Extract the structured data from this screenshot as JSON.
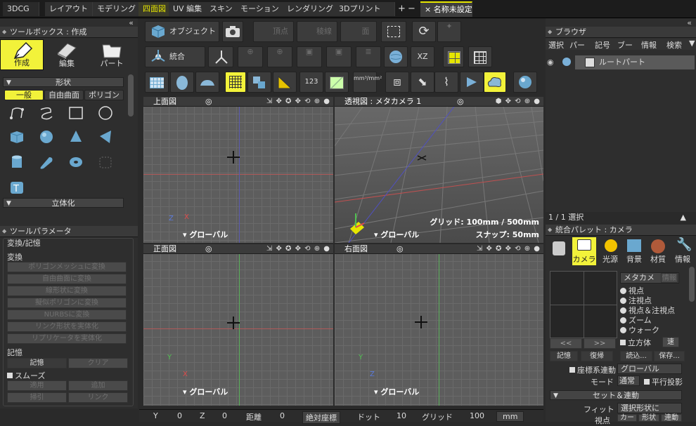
{
  "topbar": {
    "app_title": "3DCG",
    "tabs": [
      "レイアウト",
      "モデリング",
      "四面図",
      "UV 編集",
      "スキン",
      "モーション",
      "レンダリング",
      "3Dプリント"
    ],
    "add_symbol": "+",
    "minus_symbol": "−",
    "doc_close": "×",
    "doc_title": "名称未設定"
  },
  "toolbox": {
    "header": "ツールボックス : 作成",
    "collapse": "«",
    "modes": [
      "作成",
      "編集",
      "パート"
    ],
    "shape_section": "形状",
    "shape_tabs": [
      "一般",
      "自由曲面",
      "ポリゴン"
    ],
    "solid_section": "立体化"
  },
  "toolparam": {
    "header": "ツールパラメータ",
    "group_title": "変換/記憶",
    "convert_label": "変換",
    "convert_buttons": [
      "ポリゴンメッシュに変換",
      "自由曲面に変換",
      "線形状に変換",
      "擬似ポリゴンに変換",
      "NURBSに変換",
      "リンク形状を実体化",
      "リプリケータを実体化"
    ],
    "memory_label": "記憶",
    "memory_button": "記憶",
    "clear_button": "クリア",
    "smooth_label": "スムーズ",
    "apply_button": "適用",
    "add_button": "追加",
    "subtract_button": "掃引",
    "link_button": "リンク"
  },
  "toolbar": {
    "object_button": "オブジェクト",
    "vertex_button": "頂点",
    "edge_button": "稜線",
    "face_button": "面",
    "integrate_button": "統合",
    "xz_label": "XZ",
    "num_label": "123",
    "unit_label": "mm³/mm²"
  },
  "viewports": {
    "top": {
      "title": "上面図",
      "global": "グローバル"
    },
    "persp": {
      "title": "透視図 : メタカメラ 1",
      "global": "グローバル",
      "grid_info": "グリッド: 100mm / 500mm",
      "snap_info": "スナップ: 50mm"
    },
    "front": {
      "title": "正面図",
      "global": "グローバル"
    },
    "right": {
      "title": "右面図",
      "global": "グローバル"
    },
    "axis_x": "X",
    "axis_y": "Y",
    "axis_z": "Z"
  },
  "status": {
    "y_label": "Y",
    "y_value": "0",
    "z_label": "Z",
    "z_value": "0",
    "dist_label": "距離",
    "dist_value": "0",
    "coord_mode": "絶対座標",
    "dot_label": "ドット",
    "dot_value": "10",
    "grid_label": "グリッド",
    "grid_value": "100",
    "unit": "mm"
  },
  "browser": {
    "header": "ブラウザ",
    "menu": [
      "選択",
      "パー",
      "記号",
      "ブー",
      "情報",
      "検索"
    ],
    "root_part": "ルートパート",
    "selection_count": "1 / 1 選択"
  },
  "palette": {
    "header": "統合パレット : カメラ",
    "tabs": [
      "カメラ",
      "光源",
      "背景",
      "材質",
      "情報"
    ],
    "camera_name": "メタカメ",
    "camera_btn": "情報",
    "options": [
      "視点",
      "注視点",
      "視点＆注視点",
      "ズーム",
      "ウォーク"
    ],
    "cube_label": "立方体",
    "speed_btn": "速",
    "prev": "<<",
    "next": ">>",
    "memory_btn": "記憶",
    "restore_btn": "復帰",
    "load_btn": "読込...",
    "save_btn": "保存...",
    "coord_link": "座標系連動",
    "coord_value": "グローバル",
    "mode_label": "モード",
    "mode_value": "通常",
    "parallel": "平行投影",
    "set_section": "セット＆連動",
    "fit_label": "フィット",
    "fit_value": "選択形状に",
    "view_label": "視点",
    "view_value": "カー",
    "shape_value": "形状",
    "link_value": "連動"
  }
}
